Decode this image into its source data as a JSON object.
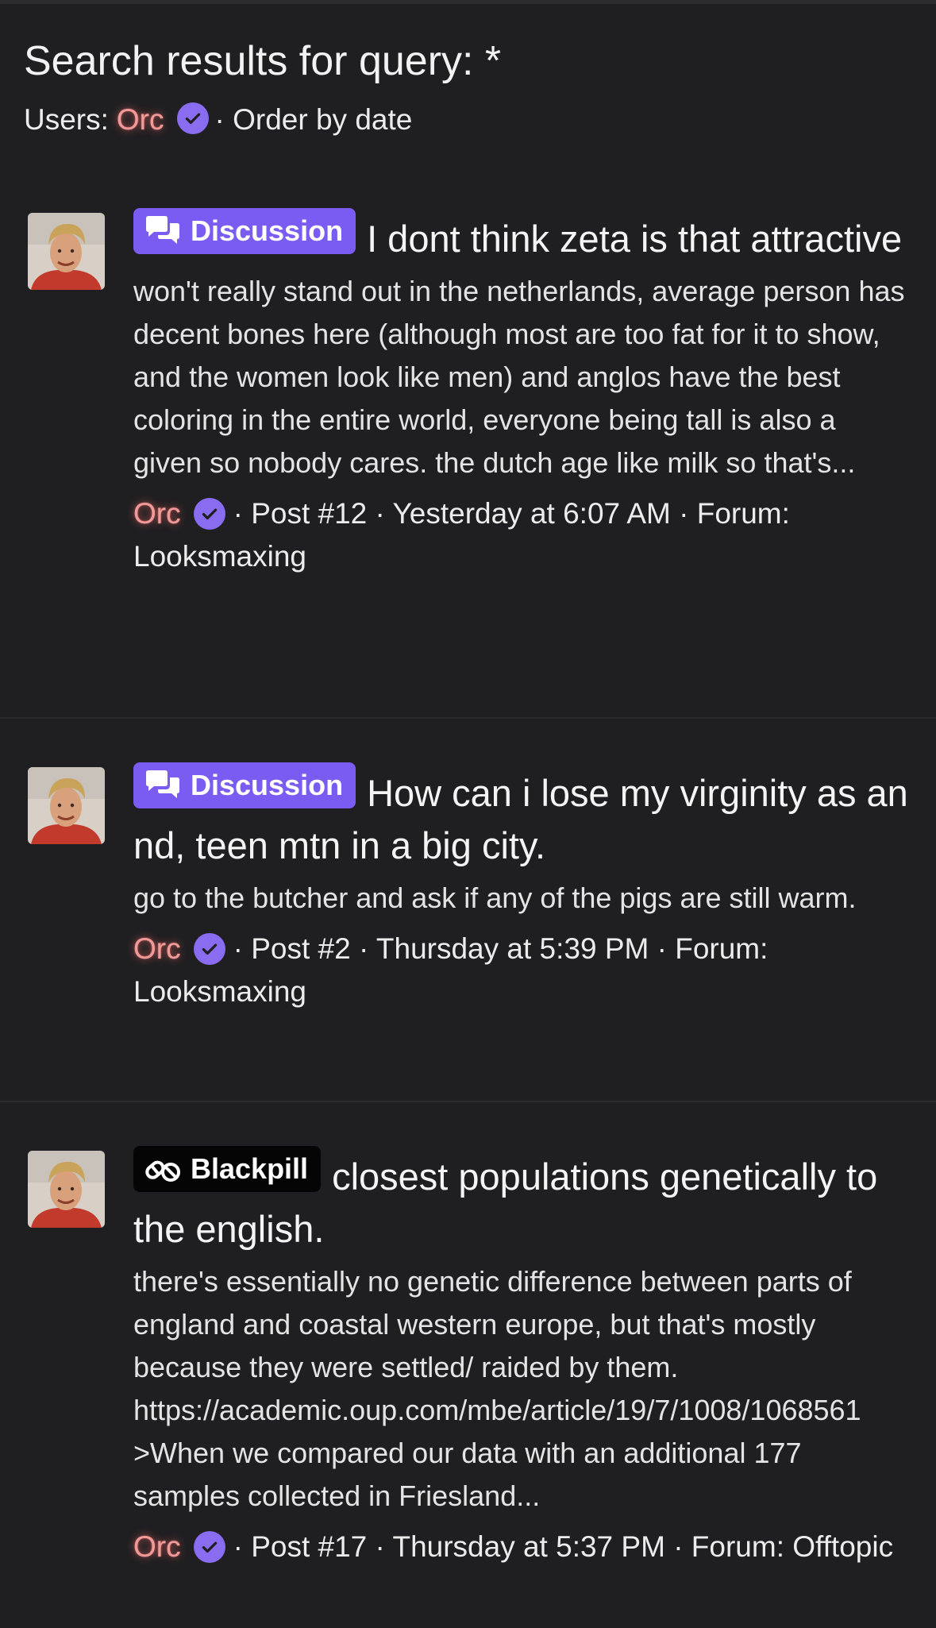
{
  "header": {
    "title": "Search results for query: *",
    "users_label": "Users:",
    "user": "Orc",
    "order_label": "· Order by date"
  },
  "results": [
    {
      "badge": "Discussion",
      "badge_icon": "chat-bubbles-icon",
      "title": "I dont think zeta is that attractive",
      "snippet": "won't really stand out in the netherlands, average person has decent bones here (although most are too fat for it to show, and the women look like men) and anglos have the best coloring in the entire world, everyone being tall is also a given so nobody cares. the dutch age like milk so that's...",
      "author": "Orc",
      "meta": "· Post #12 · Yesterday at 6:07 AM · Forum: Looksmaxing"
    },
    {
      "badge": "Discussion",
      "badge_icon": "chat-bubbles-icon",
      "title": "How can i lose my virginity as an nd, teen mtn in a big city.",
      "snippet": "go to the butcher and ask if any of the pigs are still warm.",
      "author": "Orc",
      "meta": "· Post #2 · Thursday at 5:39 PM · Forum: Looksmaxing"
    },
    {
      "badge": "Blackpill",
      "badge_icon": "pills-icon",
      "title": "closest populations genetically to the english.",
      "snippet": "there's essentially no genetic difference between parts of england and coastal western europe, but that's mostly because they were settled/ raided by them. https://academic.oup.com/mbe/article/19/7/1008/1068561 >When we compared our data with an additional 177 samples collected in Friesland...",
      "author": "Orc",
      "meta": "· Post #17 · Thursday at 5:37 PM · Forum: Offtopic"
    }
  ],
  "colors": {
    "background": "#1f1f21",
    "username": "#f29a98",
    "verified": "#8a6cf0",
    "discussion_badge": "#7b5cf2",
    "blackpill_badge": "#050505"
  }
}
